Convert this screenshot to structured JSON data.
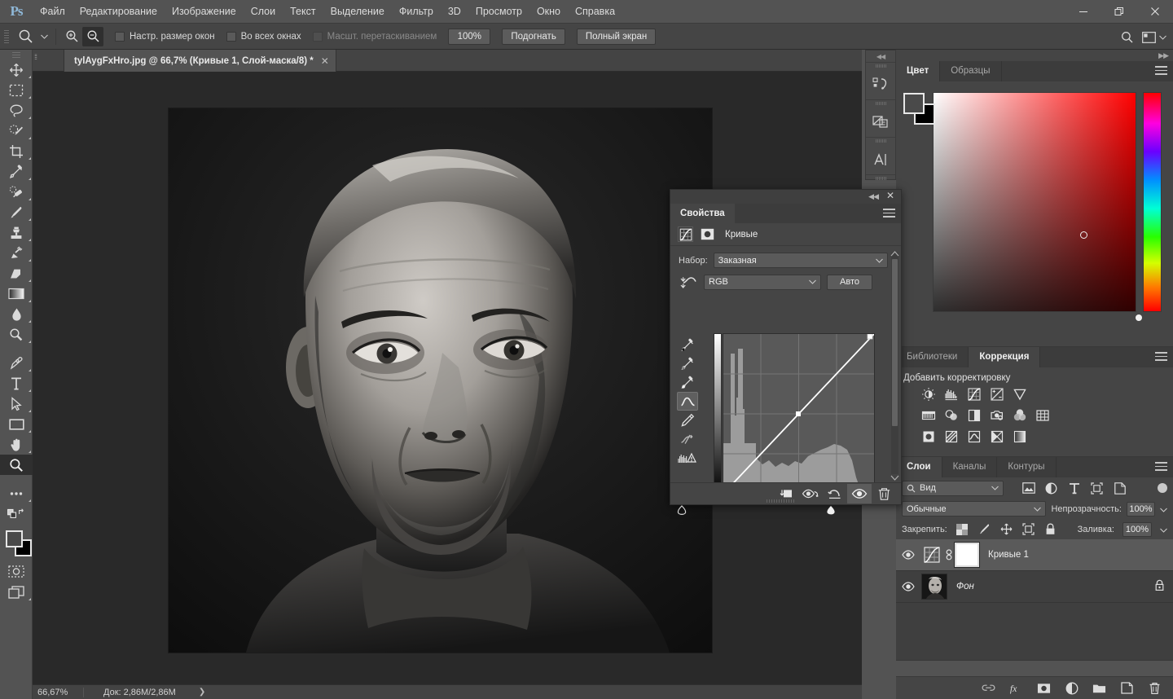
{
  "app": {
    "logo": "Ps",
    "menus": [
      "Файл",
      "Редактирование",
      "Изображение",
      "Слои",
      "Текст",
      "Выделение",
      "Фильтр",
      "3D",
      "Просмотр",
      "Окно",
      "Справка"
    ],
    "window_controls": [
      {
        "name": "minimize-button",
        "glyph": "—"
      },
      {
        "name": "restore-button",
        "glyph": "❐"
      },
      {
        "name": "close-button",
        "glyph": "✕"
      }
    ]
  },
  "options_bar": {
    "tool_icon": "zoom-tool-icon",
    "zoom_in_label": "zoom-in",
    "zoom_out_label": "zoom-out",
    "checkboxes": [
      {
        "label": "Настр. размер окон",
        "checked": false,
        "disabled": false
      },
      {
        "label": "Во всех окнах",
        "checked": false,
        "disabled": false
      },
      {
        "label": "Масшт. перетаскиванием",
        "checked": false,
        "disabled": true
      }
    ],
    "buttons": [
      "100%",
      "Подогнать",
      "Полный экран"
    ],
    "search_icon": "search-icon",
    "workspace_icon": "workspace-switcher-icon"
  },
  "toolbar": {
    "tools": [
      {
        "name": "move-tool",
        "icon": "move-icon",
        "has_submenu": true,
        "active": false
      },
      {
        "name": "rectangular-marquee-tool",
        "icon": "marquee-icon",
        "has_submenu": true,
        "active": false
      },
      {
        "name": "lasso-tool",
        "icon": "lasso-icon",
        "has_submenu": true,
        "active": false
      },
      {
        "name": "quick-selection-tool",
        "icon": "quick-select-icon",
        "has_submenu": true,
        "active": false
      },
      {
        "name": "crop-tool",
        "icon": "crop-icon",
        "has_submenu": true,
        "active": false
      },
      {
        "name": "eyedropper-tool",
        "icon": "eyedropper-icon",
        "has_submenu": true,
        "active": false
      },
      {
        "name": "spot-healing-brush-tool",
        "icon": "healing-icon",
        "has_submenu": true,
        "active": false
      },
      {
        "name": "brush-tool",
        "icon": "brush-icon",
        "has_submenu": true,
        "active": false
      },
      {
        "name": "clone-stamp-tool",
        "icon": "stamp-icon",
        "has_submenu": true,
        "active": false
      },
      {
        "name": "history-brush-tool",
        "icon": "history-brush-icon",
        "has_submenu": true,
        "active": false
      },
      {
        "name": "eraser-tool",
        "icon": "eraser-icon",
        "has_submenu": true,
        "active": false
      },
      {
        "name": "gradient-tool",
        "icon": "gradient-icon",
        "has_submenu": true,
        "active": false
      },
      {
        "name": "blur-tool",
        "icon": "blur-drop-icon",
        "has_submenu": true,
        "active": false
      },
      {
        "name": "dodge-tool",
        "icon": "dodge-icon",
        "has_submenu": true,
        "active": false
      },
      {
        "name": "pen-tool",
        "icon": "pen-icon",
        "has_submenu": true,
        "active": false
      },
      {
        "name": "type-tool",
        "icon": "type-t-icon",
        "has_submenu": true,
        "active": false
      },
      {
        "name": "path-selection-tool",
        "icon": "arrow-cursor-icon",
        "has_submenu": true,
        "active": false
      },
      {
        "name": "rectangle-tool",
        "icon": "rectangle-icon",
        "has_submenu": true,
        "active": false
      },
      {
        "name": "hand-tool",
        "icon": "hand-icon",
        "has_submenu": true,
        "active": false
      },
      {
        "name": "zoom-tool",
        "icon": "magnifier-icon",
        "has_submenu": false,
        "active": true
      },
      {
        "name": "edit-toolbar-tool",
        "icon": "ellipsis-icon",
        "has_submenu": true,
        "active": false
      },
      {
        "name": "default-colors-tool",
        "icon": "default-colors-icon",
        "has_submenu": false,
        "active": false
      },
      {
        "name": "quick-mask-tool",
        "icon": "quick-mask-icon",
        "has_submenu": false,
        "active": false
      },
      {
        "name": "screen-mode-tool",
        "icon": "screen-mode-icon",
        "has_submenu": false,
        "active": false
      }
    ],
    "foreground_color": "#4a4a4a",
    "background_color": "#000000"
  },
  "document": {
    "tab_title": "tylAygFxHro.jpg @ 66,7% (Кривые 1, Слой-маска/8) *",
    "close_glyph": "✕"
  },
  "status_bar": {
    "zoom": "66,67%",
    "doc_info": "Док: 2,86M/2,86M",
    "arrow": "❯"
  },
  "mini_dock": {
    "collapse_glyph": "◀◀",
    "items": [
      {
        "name": "history-panel-icon",
        "icon": "history-icon"
      },
      {
        "name": "layer-comps-panel-icon",
        "icon": "layer-comps-icon"
      },
      {
        "name": "character-panel-icon",
        "icon": "character-icon"
      },
      {
        "name": "paragraph-panel-icon",
        "icon": "paragraph-icon"
      }
    ]
  },
  "color_panel": {
    "expand_glyph": "▶▶",
    "tabs": [
      {
        "label": "Цвет",
        "active": true
      },
      {
        "label": "Образцы",
        "active": false
      }
    ],
    "menu_icon": "panel-menu-icon",
    "foreground_color": "#4a4a4a",
    "background_color": "#000000",
    "ramp_type": "white-to-red-with-black",
    "hue_strip": "rainbow"
  },
  "adjustments_panel": {
    "tabs": [
      {
        "label": "Библиотеки",
        "active": false
      },
      {
        "label": "Коррекция",
        "active": true
      }
    ],
    "menu_icon": "panel-menu-icon",
    "title": "Добавить корректировку",
    "rows": [
      [
        "brightness-contrast-icon",
        "levels-icon",
        "curves-icon",
        "exposure-icon",
        "vibrance-icon"
      ],
      [
        "hue-saturation-icon",
        "color-balance-icon",
        "black-white-icon",
        "photo-filter-icon",
        "channel-mixer-icon",
        "color-lookup-icon"
      ],
      [
        "invert-icon",
        "posterize-icon",
        "threshold-icon",
        "gradient-map-icon",
        "selective-color-icon"
      ]
    ]
  },
  "layers_panel": {
    "tabs": [
      {
        "label": "Слои",
        "active": true
      },
      {
        "label": "Каналы",
        "active": false
      },
      {
        "label": "Контуры",
        "active": false
      }
    ],
    "menu_icon": "panel-menu-icon",
    "filter_label": "Вид",
    "filter_icons": [
      "pixel-filter-icon",
      "adjustment-filter-icon",
      "type-filter-icon",
      "shape-filter-icon",
      "smart-object-filter-icon"
    ],
    "blend_mode": "Обычные",
    "opacity_label": "Непрозрачность:",
    "opacity_value": "100%",
    "lock_label": "Закрепить:",
    "lock_icons": [
      "lock-transparency-icon",
      "lock-image-icon",
      "lock-position-icon",
      "lock-artboard-icon",
      "lock-all-icon"
    ],
    "fill_label": "Заливка:",
    "fill_value": "100%",
    "layers": [
      {
        "name": "Кривые 1",
        "type": "adjustment",
        "visible": true,
        "selected": true,
        "has_mask": true,
        "linked": true,
        "italic": false,
        "locked": false
      },
      {
        "name": "Фон",
        "type": "image",
        "visible": true,
        "selected": false,
        "has_mask": false,
        "linked": false,
        "italic": true,
        "locked": true
      }
    ],
    "bottom_icons": [
      "link-layers-icon",
      "layer-style-fx-icon",
      "add-mask-icon",
      "new-adjustment-icon",
      "new-group-icon",
      "new-layer-icon",
      "delete-layer-icon"
    ]
  },
  "properties_panel": {
    "collapse_glyph": "◀◀",
    "close_glyph": "✕",
    "tab_label": "Свойства",
    "header_icons": [
      "curves-properties-icon",
      "mask-properties-icon"
    ],
    "header_title": "Кривые",
    "preset_label": "Набор:",
    "preset_value": "Заказная",
    "channel_icon": "on-image-adjust-icon",
    "channel_value": "RGB",
    "auto_button": "Авто",
    "curve_tools": [
      {
        "name": "black-point-eyedropper",
        "icon": "eyedropper-black-icon",
        "active": false
      },
      {
        "name": "gray-point-eyedropper",
        "icon": "eyedropper-gray-icon",
        "active": false
      },
      {
        "name": "white-point-eyedropper",
        "icon": "eyedropper-white-icon",
        "active": false
      },
      {
        "name": "curve-point-tool",
        "icon": "curve-point-icon",
        "active": true
      },
      {
        "name": "pencil-curve-tool",
        "icon": "pencil-icon",
        "active": false
      },
      {
        "name": "smooth-curve-tool",
        "icon": "smooth-curve-icon",
        "active": false
      },
      {
        "name": "histogram-warning",
        "icon": "histogram-warning-icon",
        "active": false
      }
    ],
    "bottom_icons": [
      {
        "name": "clip-to-layer-button",
        "icon": "clip-to-layer-icon",
        "active": false
      },
      {
        "name": "toggle-previous-state-button",
        "icon": "previous-state-icon",
        "active": false
      },
      {
        "name": "reset-button",
        "icon": "reset-icon",
        "active": false
      },
      {
        "name": "toggle-visibility-button",
        "icon": "eye-icon",
        "active": true
      },
      {
        "name": "delete-adjustment-button",
        "icon": "trash-icon",
        "active": false
      }
    ],
    "curve_data": {
      "type": "line",
      "channel": "RGB",
      "xlim": [
        0,
        255
      ],
      "ylim": [
        0,
        255
      ],
      "grid_divisions": 4,
      "points": [
        {
          "input": 0,
          "output": 0
        },
        {
          "input": 128,
          "output": 128
        },
        {
          "input": 255,
          "output": 255
        }
      ],
      "black_slider_input": 0,
      "white_slider_input": 255,
      "histogram_description": "tall narrow shadow spike near input 10-25, broad midtone plateau from input 70 to 200"
    }
  }
}
